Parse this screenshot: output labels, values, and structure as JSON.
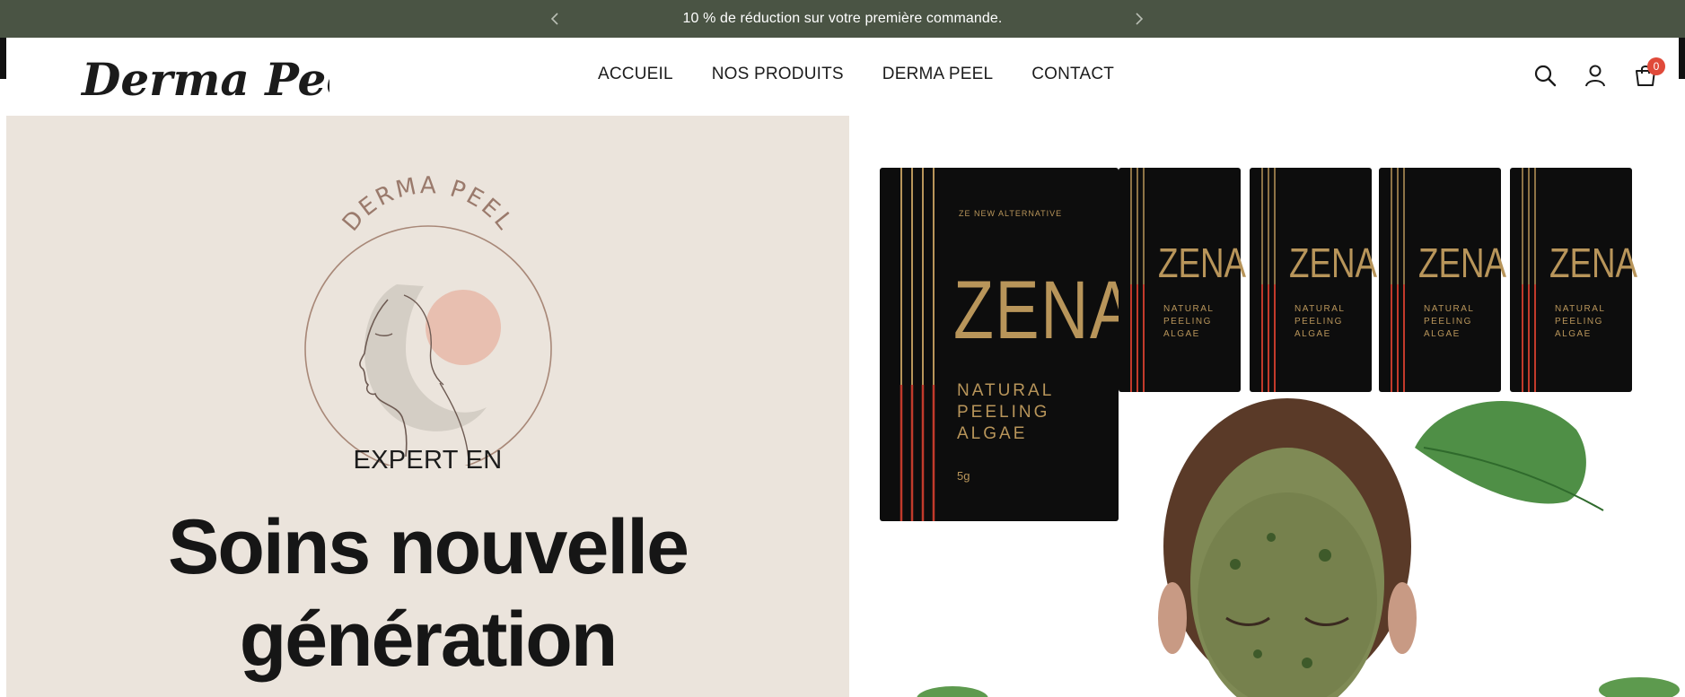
{
  "announcement": {
    "text": "10 % de réduction sur votre première commande.",
    "prev_icon": "chevron-left-icon",
    "next_icon": "chevron-right-icon"
  },
  "header": {
    "logo_text": "Derma Peel",
    "nav": [
      "ACCUEIL",
      "NOS PRODUITS",
      "DERMA PEEL",
      "CONTACT"
    ],
    "icons": [
      "search-icon",
      "account-icon",
      "cart-icon"
    ],
    "cart_count": "0"
  },
  "hero": {
    "emblem_text": "DERMA PEEL",
    "kicker": "EXPERT EN",
    "headline_line1": "Soins nouvelle",
    "headline_line2": "génération"
  },
  "product": {
    "tagline": "ZE NEW ALTERNATIVE",
    "brand": "ZENA",
    "line1": "NATURAL",
    "line2": "PEELING",
    "line3": "ALGAE",
    "weight": "5g"
  },
  "colors": {
    "announce_bg": "#4a5444",
    "hero_bg": "#ebe4dc",
    "accent_badge": "#e04a3a",
    "packet_black": "#0d0d0d",
    "packet_gold": "#b8955a",
    "packet_red": "#c23a2b"
  }
}
